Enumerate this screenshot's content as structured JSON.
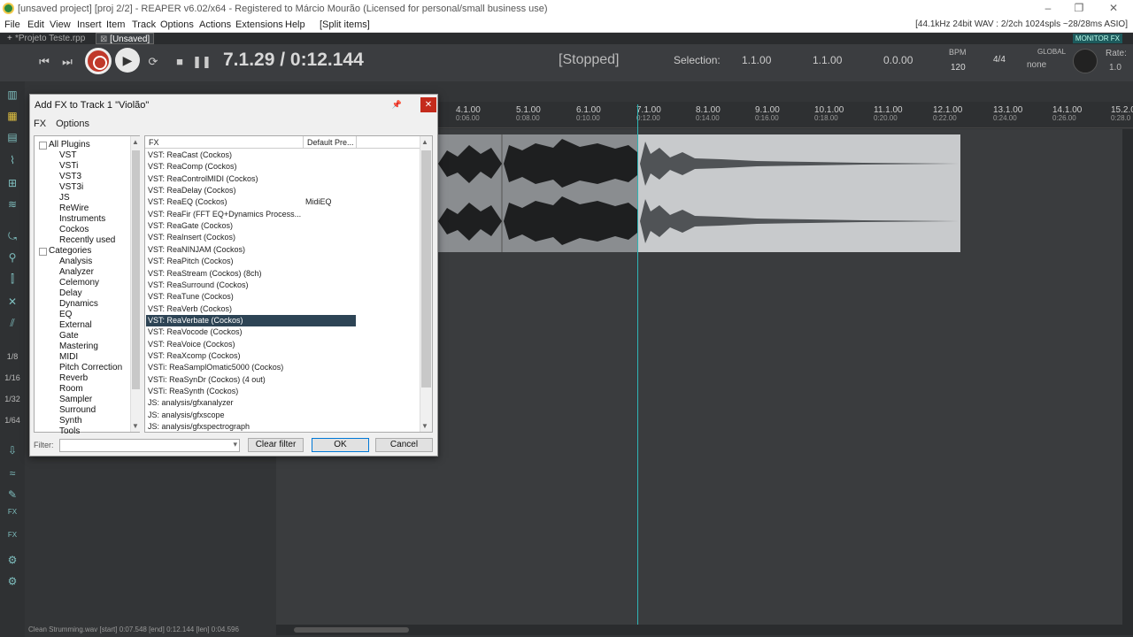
{
  "window": {
    "title": "[unsaved project] [proj 2/2] - REAPER v6.02/x64 - Registered to Márcio Mourão (Licensed for personal/small business use)"
  },
  "menu": {
    "items": [
      "File",
      "Edit",
      "View",
      "Insert",
      "Item",
      "Track",
      "Options",
      "Actions",
      "Extensions",
      "Help",
      "[Split items]"
    ],
    "audio_status": "[44.1kHz 24bit WAV : 2/2ch 1024spls ~28/28ms ASIO]"
  },
  "tabs": [
    "*Projeto Teste.rpp",
    "[Unsaved]"
  ],
  "monitor_fx": "MONITOR FX",
  "transport": {
    "time": "7.1.29 / 0:12.144",
    "state": "[Stopped]",
    "selection_label": "Selection:",
    "sel_start": "1.1.00",
    "sel_end": "1.1.00",
    "sel_len": "0.0.00",
    "bpm_label": "BPM",
    "bpm": "120",
    "signature": "4/4",
    "global": "GLOBAL",
    "global_value": "none",
    "rate_label": "Rate:",
    "rate": "1.0"
  },
  "left_toolbar": {
    "grid": [
      "1/8",
      "1/16",
      "1/32",
      "1/64"
    ],
    "fx1": "FX",
    "fx2": "FX"
  },
  "ruler": {
    "marks": [
      {
        "l": "4.1.00",
        "t": "0:06.00"
      },
      {
        "l": "5.1.00",
        "t": "0:08.00"
      },
      {
        "l": "6.1.00",
        "t": "0:10.00"
      },
      {
        "l": "7.1.00",
        "t": "0:12.00"
      },
      {
        "l": "8.1.00",
        "t": "0:14.00"
      },
      {
        "l": "9.1.00",
        "t": "0:16.00"
      },
      {
        "l": "10.1.00",
        "t": "0:18.00"
      },
      {
        "l": "11.1.00",
        "t": "0:20.00"
      },
      {
        "l": "12.1.00",
        "t": "0:22.00"
      },
      {
        "l": "13.1.00",
        "t": "0:24.00"
      },
      {
        "l": "14.1.00",
        "t": "0:26.00"
      },
      {
        "l": "15.2.0",
        "t": "0:28.0"
      }
    ]
  },
  "statusline": "Clean Strumming.wav [start] 0:07.548 [end] 0:12.144 [len] 0:04.596",
  "dialog": {
    "title": "Add FX to Track 1 \"Violão\"",
    "menu": [
      "FX",
      "Options"
    ],
    "tree": [
      {
        "label": "All Plugins",
        "folder": true
      },
      {
        "label": "VST"
      },
      {
        "label": "VSTi"
      },
      {
        "label": "VST3"
      },
      {
        "label": "VST3i"
      },
      {
        "label": "JS"
      },
      {
        "label": "ReWire"
      },
      {
        "label": "Instruments"
      },
      {
        "label": "Cockos"
      },
      {
        "label": "Recently used"
      },
      {
        "label": "Categories",
        "folder": true
      },
      {
        "label": "Analysis"
      },
      {
        "label": "Analyzer"
      },
      {
        "label": "Celemony"
      },
      {
        "label": "Delay"
      },
      {
        "label": "Dynamics"
      },
      {
        "label": "EQ"
      },
      {
        "label": "External"
      },
      {
        "label": "Gate"
      },
      {
        "label": "Mastering"
      },
      {
        "label": "MIDI"
      },
      {
        "label": "Pitch Correction"
      },
      {
        "label": "Reverb"
      },
      {
        "label": "Room"
      },
      {
        "label": "Sampler"
      },
      {
        "label": "Surround"
      },
      {
        "label": "Synth"
      },
      {
        "label": "Tools"
      }
    ],
    "columns": [
      "FX",
      "Default Pre..."
    ],
    "fx": [
      {
        "name": "VST: ReaCast (Cockos)",
        "preset": ""
      },
      {
        "name": "VST: ReaComp (Cockos)",
        "preset": ""
      },
      {
        "name": "VST: ReaControlMIDI (Cockos)",
        "preset": ""
      },
      {
        "name": "VST: ReaDelay (Cockos)",
        "preset": ""
      },
      {
        "name": "VST: ReaEQ (Cockos)",
        "preset": "MidiEQ"
      },
      {
        "name": "VST: ReaFir (FFT EQ+Dynamics Process...",
        "preset": ""
      },
      {
        "name": "VST: ReaGate (Cockos)",
        "preset": ""
      },
      {
        "name": "VST: ReaInsert (Cockos)",
        "preset": ""
      },
      {
        "name": "VST: ReaNINJAM (Cockos)",
        "preset": ""
      },
      {
        "name": "VST: ReaPitch (Cockos)",
        "preset": ""
      },
      {
        "name": "VST: ReaStream (Cockos) (8ch)",
        "preset": ""
      },
      {
        "name": "VST: ReaSurround (Cockos)",
        "preset": ""
      },
      {
        "name": "VST: ReaTune (Cockos)",
        "preset": ""
      },
      {
        "name": "VST: ReaVerb (Cockos)",
        "preset": ""
      },
      {
        "name": "VST: ReaVerbate (Cockos)",
        "preset": "",
        "selected": true
      },
      {
        "name": "VST: ReaVocode (Cockos)",
        "preset": ""
      },
      {
        "name": "VST: ReaVoice (Cockos)",
        "preset": ""
      },
      {
        "name": "VST: ReaXcomp (Cockos)",
        "preset": ""
      },
      {
        "name": "VSTi: ReaSamplOmatic5000 (Cockos)",
        "preset": ""
      },
      {
        "name": "VSTi: ReaSynDr (Cockos) (4 out)",
        "preset": ""
      },
      {
        "name": "VSTi: ReaSynth (Cockos)",
        "preset": ""
      },
      {
        "name": "JS: analysis/gfxanalyzer",
        "preset": ""
      },
      {
        "name": "JS: analysis/gfxscope",
        "preset": ""
      },
      {
        "name": "JS: analysis/gfxspectrograph",
        "preset": ""
      }
    ],
    "filter_label": "Filter:",
    "filter_value": "",
    "clear_filter": "Clear filter",
    "ok": "OK",
    "cancel": "Cancel"
  },
  "colors": {
    "selected_row": "#2d4455",
    "playhead": "#2fb5b5",
    "record": "#c0392b"
  }
}
